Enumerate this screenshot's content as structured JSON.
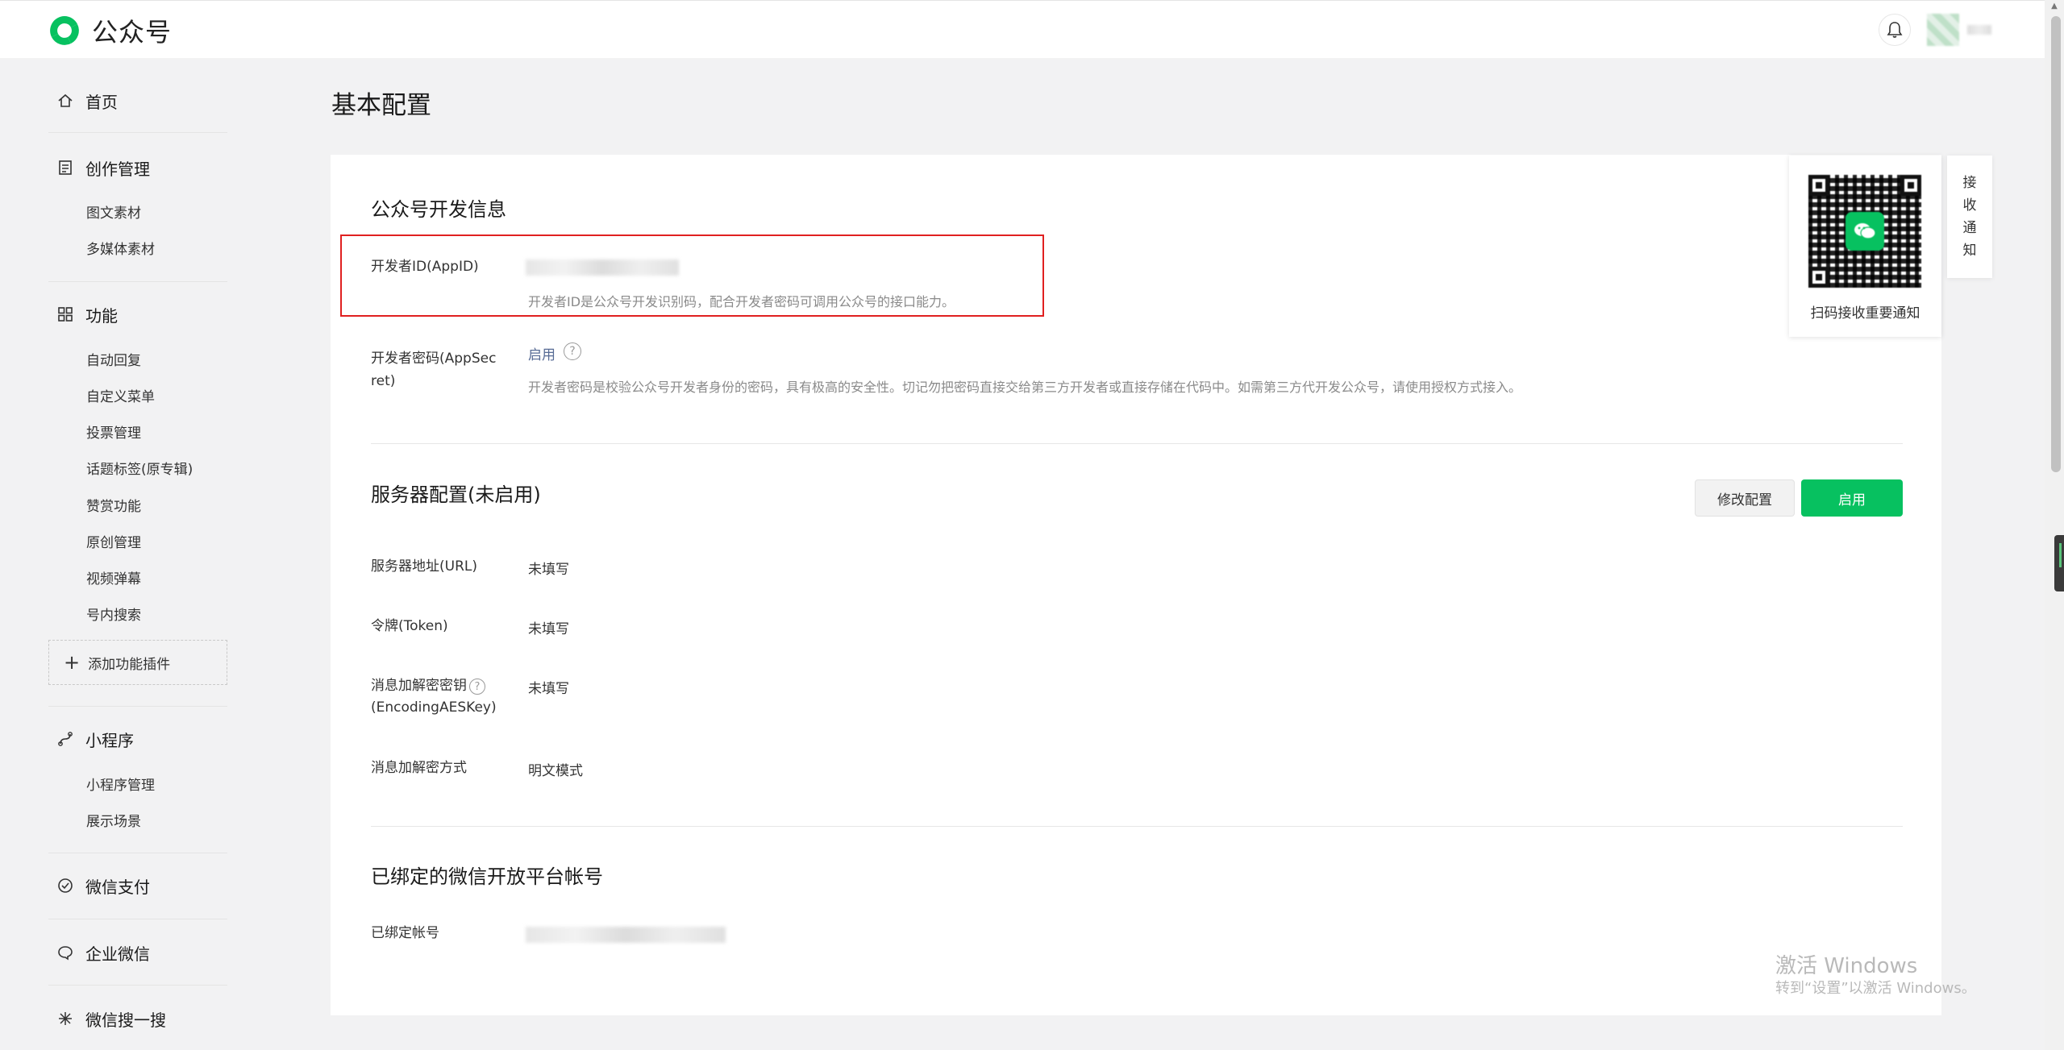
{
  "app": {
    "title": "公众号"
  },
  "sidebar": {
    "home": "首页",
    "creation": {
      "label": "创作管理",
      "items": [
        "图文素材",
        "多媒体素材"
      ]
    },
    "features": {
      "label": "功能",
      "items": [
        "自动回复",
        "自定义菜单",
        "投票管理",
        "话题标签(原专辑)",
        "赞赏功能",
        "原创管理",
        "视频弹幕",
        "号内搜索"
      ]
    },
    "add_plugin": "添加功能插件",
    "miniprogram": {
      "label": "小程序",
      "items": [
        "小程序管理",
        "展示场景"
      ]
    },
    "wechat_pay": "微信支付",
    "work_wechat": "企业微信",
    "wechat_search": "微信搜一搜"
  },
  "page": {
    "title": "基本配置"
  },
  "dev_info": {
    "title": "公众号开发信息",
    "appid_label": "开发者ID(AppID)",
    "appid_desc": "开发者ID是公众号开发识别码，配合开发者密码可调用公众号的接口能力。",
    "secret_label_1": "开发者密码(AppSec",
    "secret_label_2": "ret)",
    "secret_action": "启用",
    "secret_desc": "开发者密码是校验公众号开发者身份的密码，具有极高的安全性。切记勿把密码直接交给第三方开发者或直接存储在代码中。如需第三方代开发公众号，请使用授权方式接入。"
  },
  "server": {
    "title": "服务器配置(未启用)",
    "modify_button": "修改配置",
    "enable_button": "启用",
    "url_label": "服务器地址(URL)",
    "url_value": "未填写",
    "token_label": "令牌(Token)",
    "token_value": "未填写",
    "aes_label_1": "消息加解密密钥",
    "aes_label_2": "(EncodingAESKey)",
    "aes_value": "未填写",
    "mode_label": "消息加解密方式",
    "mode_value": "明文模式"
  },
  "open_platform": {
    "title": "已绑定的微信开放平台帐号",
    "bound_label": "已绑定帐号"
  },
  "qr": {
    "caption": "扫码接收重要通知"
  },
  "notice_tab": [
    "接",
    "收",
    "通",
    "知"
  ],
  "watermark": {
    "line1": "激活 Windows",
    "line2": "转到“设置”以激活 Windows。"
  },
  "colors": {
    "brand_green": "#07c160",
    "highlight_red": "#e02020",
    "link_blue": "#576b95"
  }
}
